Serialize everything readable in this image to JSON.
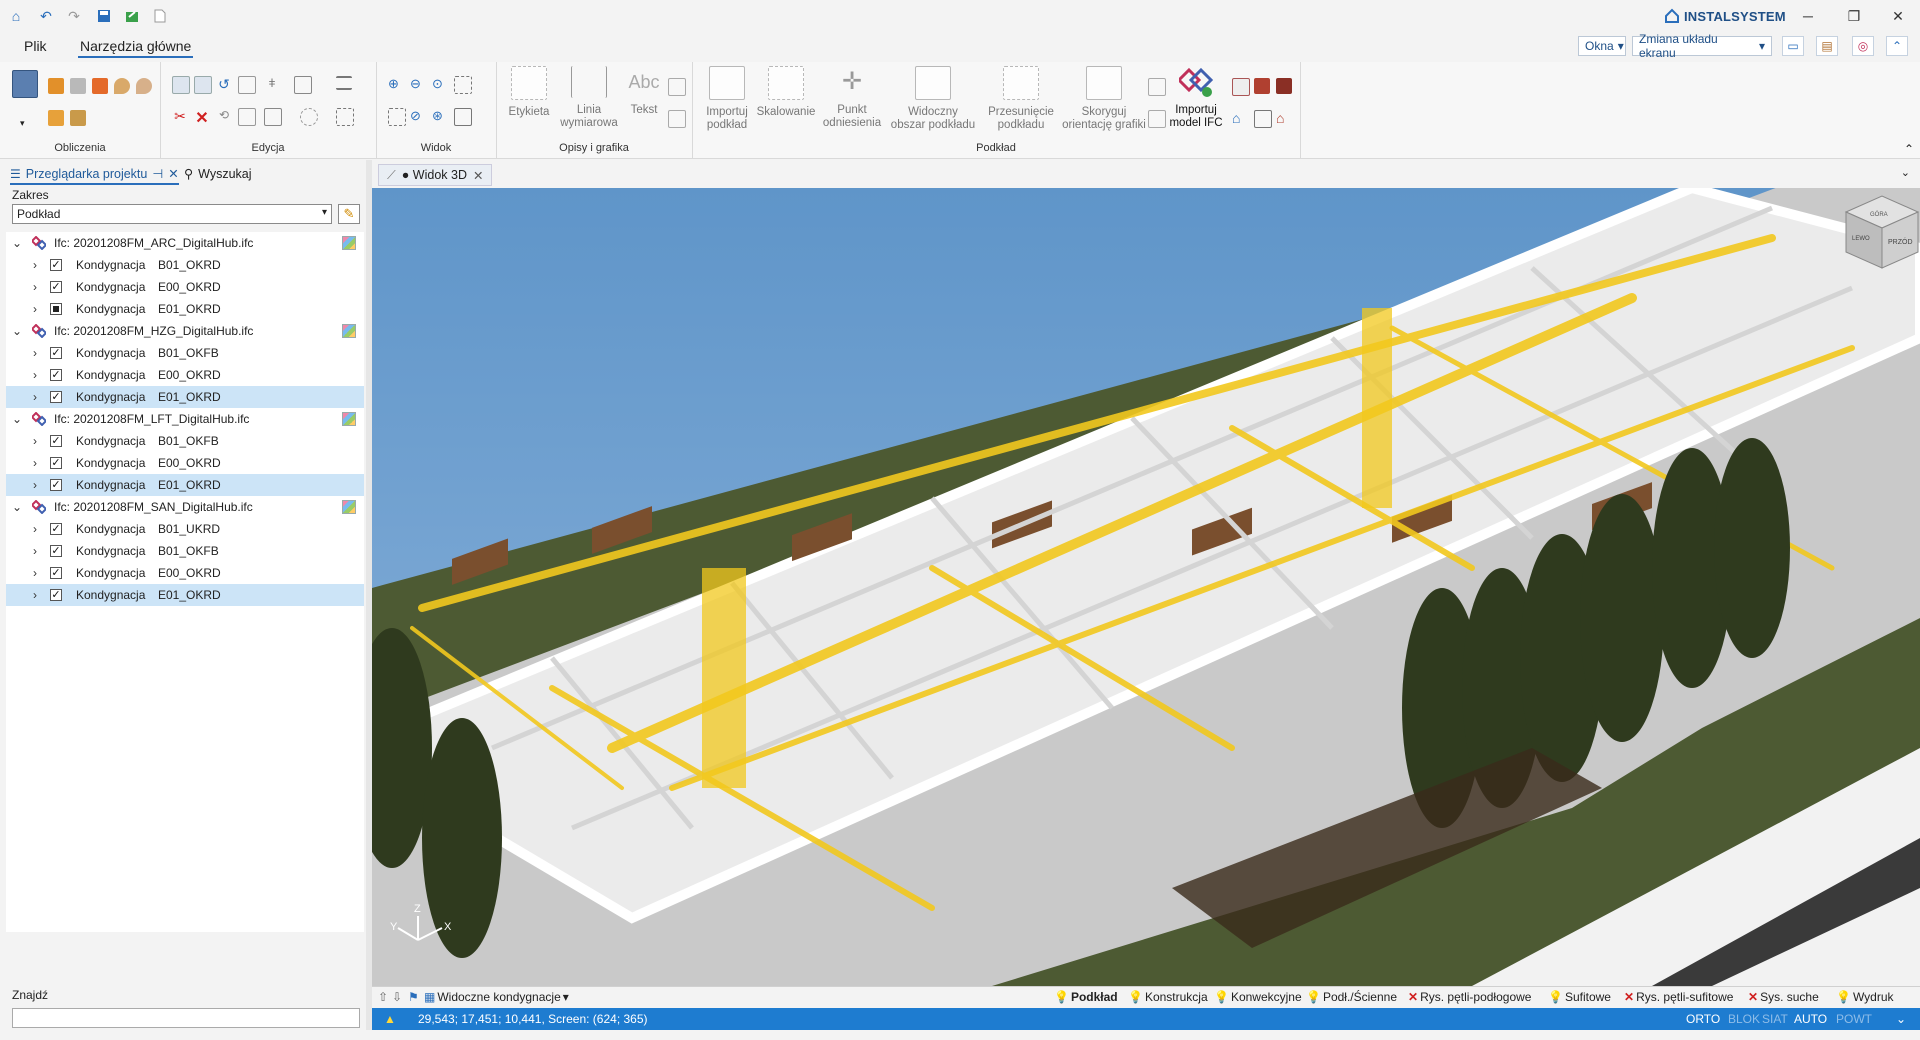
{
  "app": {
    "brand": "INSTALSYSTEM",
    "quick_access": [
      "home-icon",
      "undo-icon",
      "redo-icon",
      "save-icon",
      "export-icon",
      "new-document-icon"
    ]
  },
  "menu": {
    "tabs": [
      "Plik",
      "Narzędzia główne"
    ],
    "active_tab": "Narzędzia główne",
    "windows_dropdown": "Okna",
    "layout_dropdown": "Zmiana układu ekranu"
  },
  "ribbon": {
    "groups": {
      "obliczenia": "Obliczenia",
      "edycja": "Edycja",
      "widok": "Widok",
      "opisy": "Opisy i grafika",
      "podklad": "Podkład"
    },
    "opisy_buttons": {
      "etykieta": "Etykieta",
      "linia1": "Linia",
      "linia2": "wymiarowa",
      "tekst": "Tekst"
    },
    "podklad_buttons": {
      "importuj1": "Importuj",
      "importuj2": "podkład",
      "skalowanie": "Skalowanie",
      "punkt1": "Punkt",
      "punkt2": "odniesienia",
      "widoczny1": "Widoczny",
      "widoczny2": "obszar podkładu",
      "przes1": "Przesunięcie",
      "przes2": "podkładu",
      "skoryguj1": "Skoryguj",
      "skoryguj2": "orientację grafiki",
      "ifc1": "Importuj",
      "ifc2": "model IFC"
    }
  },
  "left_panel": {
    "tab_browser": "Przeglądarka projektu",
    "tab_search": "Wyszukaj",
    "scope_label": "Zakres",
    "scope_value": "Podkład",
    "find_label": "Znajdź",
    "tree": [
      {
        "file": "Ifc: 20201208FM_ARC_DigitalHub.ifc",
        "children": [
          {
            "name": "Kondygnacja",
            "level": "B01_OKRD",
            "check": "checked",
            "selected": false
          },
          {
            "name": "Kondygnacja",
            "level": "E00_OKRD",
            "check": "checked",
            "selected": false
          },
          {
            "name": "Kondygnacja",
            "level": "E01_OKRD",
            "check": "partial",
            "selected": false
          }
        ]
      },
      {
        "file": "Ifc: 20201208FM_HZG_DigitalHub.ifc",
        "children": [
          {
            "name": "Kondygnacja",
            "level": "B01_OKFB",
            "check": "checked",
            "selected": false
          },
          {
            "name": "Kondygnacja",
            "level": "E00_OKRD",
            "check": "checked",
            "selected": false
          },
          {
            "name": "Kondygnacja",
            "level": "E01_OKRD",
            "check": "checked",
            "selected": true
          }
        ]
      },
      {
        "file": "Ifc: 20201208FM_LFT_DigitalHub.ifc",
        "children": [
          {
            "name": "Kondygnacja",
            "level": "B01_OKFB",
            "check": "checked",
            "selected": false
          },
          {
            "name": "Kondygnacja",
            "level": "E00_OKRD",
            "check": "checked",
            "selected": false
          },
          {
            "name": "Kondygnacja",
            "level": "E01_OKRD",
            "check": "checked",
            "selected": true
          }
        ]
      },
      {
        "file": "Ifc: 20201208FM_SAN_DigitalHub.ifc",
        "children": [
          {
            "name": "Kondygnacja",
            "level": "B01_UKRD",
            "check": "checked",
            "selected": false
          },
          {
            "name": "Kondygnacja",
            "level": "B01_OKFB",
            "check": "checked",
            "selected": false
          },
          {
            "name": "Kondygnacja",
            "level": "E00_OKRD",
            "check": "checked",
            "selected": false
          },
          {
            "name": "Kondygnacja",
            "level": "E01_OKRD",
            "check": "checked",
            "selected": true
          }
        ]
      }
    ]
  },
  "view": {
    "tab_label": "● Widok 3D",
    "viewcube_top": "GÓRA",
    "viewcube_front": "PRZÓD",
    "viewcube_left": "LEWO",
    "axes": {
      "x": "X",
      "y": "Y",
      "z": "Z"
    }
  },
  "bottom_bar": {
    "visible_levels": "Widoczne kondygnacje",
    "layers": [
      {
        "label": "Podkład",
        "marker": "bulb",
        "bold": true
      },
      {
        "label": "Konstrukcja",
        "marker": "bulb",
        "bold": false
      },
      {
        "label": "Konwekcyjne",
        "marker": "bulb",
        "bold": false
      },
      {
        "label": "Podł./Ścienne",
        "marker": "bulb",
        "bold": false
      },
      {
        "label": "Rys. pętli-podłogowe",
        "marker": "cross",
        "bold": false
      },
      {
        "label": "Sufitowe",
        "marker": "bulb",
        "bold": false
      },
      {
        "label": "Rys. pętli-sufitowe",
        "marker": "cross",
        "bold": false
      },
      {
        "label": "Sys. suche",
        "marker": "cross",
        "bold": false
      },
      {
        "label": "Wydruk",
        "marker": "bulb",
        "bold": false
      }
    ]
  },
  "status": {
    "coords": "29,543; 17,451; 10,441, Screen: (624; 365)",
    "modes": [
      {
        "label": "ORTO",
        "active": true
      },
      {
        "label": "BLOK",
        "active": false
      },
      {
        "label": "SIAT",
        "active": false
      },
      {
        "label": "AUTO",
        "active": true
      },
      {
        "label": "POWT",
        "active": false
      }
    ]
  },
  "colors": {
    "accent": "#2a6ebb",
    "status_bar": "#1e7cd0",
    "selection": "#cce4f7",
    "pipes": "#f2c81e",
    "grass": "#4d5a33",
    "sky": "#6a9ccc"
  }
}
